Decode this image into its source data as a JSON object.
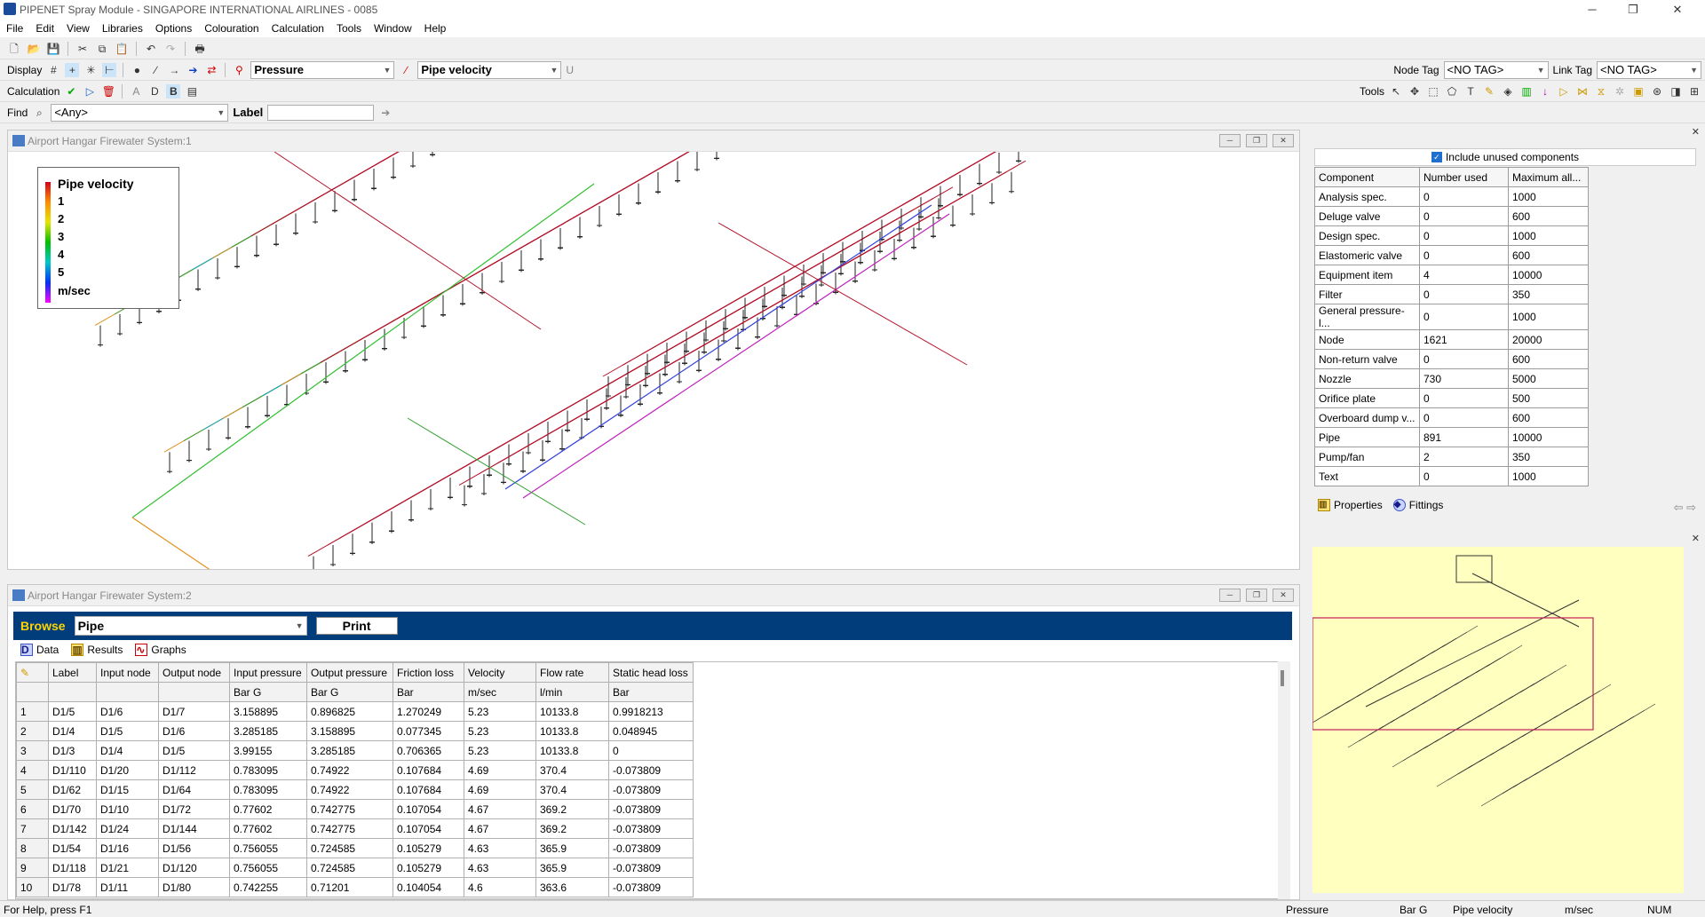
{
  "app": {
    "title": "PIPENET Spray Module - SINGAPORE INTERNATIONAL AIRLINES - 0085"
  },
  "menu": [
    "File",
    "Edit",
    "View",
    "Libraries",
    "Options",
    "Colouration",
    "Calculation",
    "Tools",
    "Window",
    "Help"
  ],
  "toolbar": {
    "display_label": "Display",
    "node_combo": "Pressure",
    "link_combo": "Pipe velocity",
    "u_label": "U",
    "node_tag_label": "Node Tag",
    "node_tag_value": "<NO TAG>",
    "link_tag_label": "Link Tag",
    "link_tag_value": "<NO TAG>",
    "calculation_label": "Calculation",
    "tools_label": "Tools",
    "find_label": "Find",
    "find_value": "<Any>",
    "label_label": "Label",
    "label_value": ""
  },
  "win1": {
    "title": "Airport Hangar Firewater System:1",
    "legend": {
      "title": "Pipe velocity",
      "values": [
        "1",
        "2",
        "3",
        "4",
        "5"
      ],
      "unit": "m/sec"
    }
  },
  "win2": {
    "title": "Airport Hangar Firewater System:2",
    "browse_label": "Browse",
    "browse_value": "Pipe",
    "print_label": "Print",
    "tabs": [
      "Data",
      "Results",
      "Graphs"
    ],
    "columns": [
      "Label",
      "Input node",
      "Output node",
      "Input pressure",
      "Output pressure",
      "Friction loss",
      "Velocity",
      "Flow rate",
      "Static head loss"
    ],
    "units": [
      "",
      "",
      "",
      "Bar G",
      "Bar G",
      "Bar",
      "m/sec",
      "l/min",
      "Bar"
    ],
    "rows": [
      [
        "1",
        "D1/5",
        "D1/6",
        "D1/7",
        "3.158895",
        "0.896825",
        "1.270249",
        "5.23",
        "10133.8",
        "0.9918213"
      ],
      [
        "2",
        "D1/4",
        "D1/5",
        "D1/6",
        "3.285185",
        "3.158895",
        "0.077345",
        "5.23",
        "10133.8",
        "0.048945"
      ],
      [
        "3",
        "D1/3",
        "D1/4",
        "D1/5",
        "3.99155",
        "3.285185",
        "0.706365",
        "5.23",
        "10133.8",
        "0"
      ],
      [
        "4",
        "D1/110",
        "D1/20",
        "D1/112",
        "0.783095",
        "0.74922",
        "0.107684",
        "4.69",
        "370.4",
        "-0.073809"
      ],
      [
        "5",
        "D1/62",
        "D1/15",
        "D1/64",
        "0.783095",
        "0.74922",
        "0.107684",
        "4.69",
        "370.4",
        "-0.073809"
      ],
      [
        "6",
        "D1/70",
        "D1/10",
        "D1/72",
        "0.77602",
        "0.742775",
        "0.107054",
        "4.67",
        "369.2",
        "-0.073809"
      ],
      [
        "7",
        "D1/142",
        "D1/24",
        "D1/144",
        "0.77602",
        "0.742775",
        "0.107054",
        "4.67",
        "369.2",
        "-0.073809"
      ],
      [
        "8",
        "D1/54",
        "D1/16",
        "D1/56",
        "0.756055",
        "0.724585",
        "0.105279",
        "4.63",
        "365.9",
        "-0.073809"
      ],
      [
        "9",
        "D1/118",
        "D1/21",
        "D1/120",
        "0.756055",
        "0.724585",
        "0.105279",
        "4.63",
        "365.9",
        "-0.073809"
      ],
      [
        "10",
        "D1/78",
        "D1/11",
        "D1/80",
        "0.742255",
        "0.71201",
        "0.104054",
        "4.6",
        "363.6",
        "-0.073809"
      ]
    ]
  },
  "components": {
    "include_unused_label": "Include unused components",
    "columns": [
      "Component",
      "Number used",
      "Maximum all..."
    ],
    "rows": [
      [
        "Analysis spec.",
        "0",
        "1000"
      ],
      [
        "Deluge valve",
        "0",
        "600"
      ],
      [
        "Design spec.",
        "0",
        "1000"
      ],
      [
        "Elastomeric valve",
        "0",
        "600"
      ],
      [
        "Equipment item",
        "4",
        "10000"
      ],
      [
        "Filter",
        "0",
        "350"
      ],
      [
        "General pressure-l...",
        "0",
        "1000"
      ],
      [
        "Node",
        "1621",
        "20000"
      ],
      [
        "Non-return valve",
        "0",
        "600"
      ],
      [
        "Nozzle",
        "730",
        "5000"
      ],
      [
        "Orifice plate",
        "0",
        "500"
      ],
      [
        "Overboard dump v...",
        "0",
        "600"
      ],
      [
        "Pipe",
        "891",
        "10000"
      ],
      [
        "Pump/fan",
        "2",
        "350"
      ],
      [
        "Text",
        "0",
        "1000"
      ]
    ],
    "tabs": [
      "Properties",
      "Fittings"
    ]
  },
  "status": {
    "help": "For Help, press F1",
    "node_var": "Pressure",
    "node_unit": "Bar G",
    "link_var": "Pipe velocity",
    "link_unit": "m/sec",
    "num": "NUM"
  },
  "colors": {
    "browse_bar": "#003d7a",
    "overview_bg": "#ffffc0",
    "pipe_red": "#b4122a"
  }
}
